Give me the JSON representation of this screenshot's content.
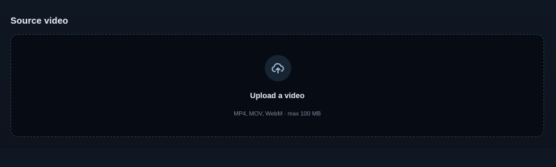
{
  "section": {
    "title": "Source video"
  },
  "upload": {
    "icon": "cloud-upload-icon",
    "title": "Upload a video",
    "hint": "MP4, MOV, WebM · max 100 MB"
  },
  "colors": {
    "background": "#0f1722",
    "dropzone_background": "#070c14",
    "dropzone_border": "#2a3646",
    "icon_circle": "#172432",
    "icon_stroke": "#aecbe6",
    "title_text": "#e6edf5",
    "hint_text": "#7b8898"
  }
}
